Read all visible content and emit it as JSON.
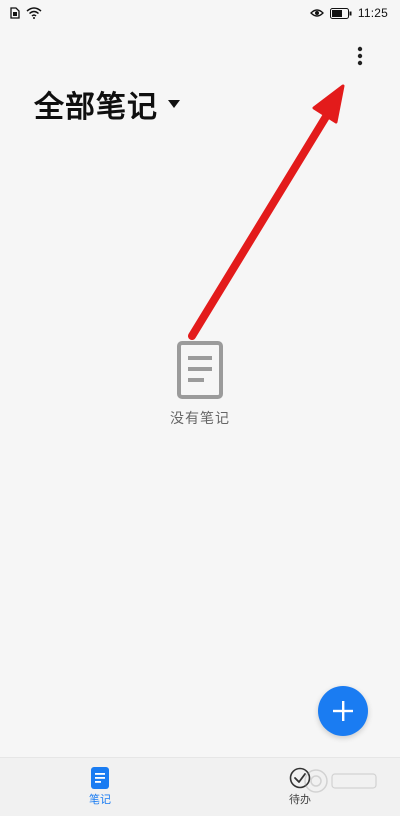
{
  "status_bar": {
    "time": "11:25",
    "left_icons": [
      "sim-card-icon",
      "wifi-icon"
    ],
    "right_icons": [
      "eye-icon",
      "battery-icon"
    ]
  },
  "header": {
    "title": "全部笔记",
    "title_dropdown_icon": "caret-down-icon",
    "menu_icon": "more-vertical-icon"
  },
  "empty_state": {
    "icon": "document-icon",
    "text": "没有笔记"
  },
  "fab": {
    "icon": "plus-icon",
    "color": "#1a7cf2"
  },
  "bottom_nav": {
    "items": [
      {
        "label": "笔记",
        "icon": "note-icon",
        "active": true
      },
      {
        "label": "待办",
        "icon": "todo-check-icon",
        "active": false
      }
    ]
  },
  "annotation": {
    "type": "red-arrow",
    "color": "#e31b1b",
    "points_to": "more-vertical-icon"
  },
  "colors": {
    "accent": "#1a7cf2",
    "background": "#f6f6f6",
    "nav_background": "#f1f1f1",
    "muted_icon": "#9b9b9b"
  }
}
